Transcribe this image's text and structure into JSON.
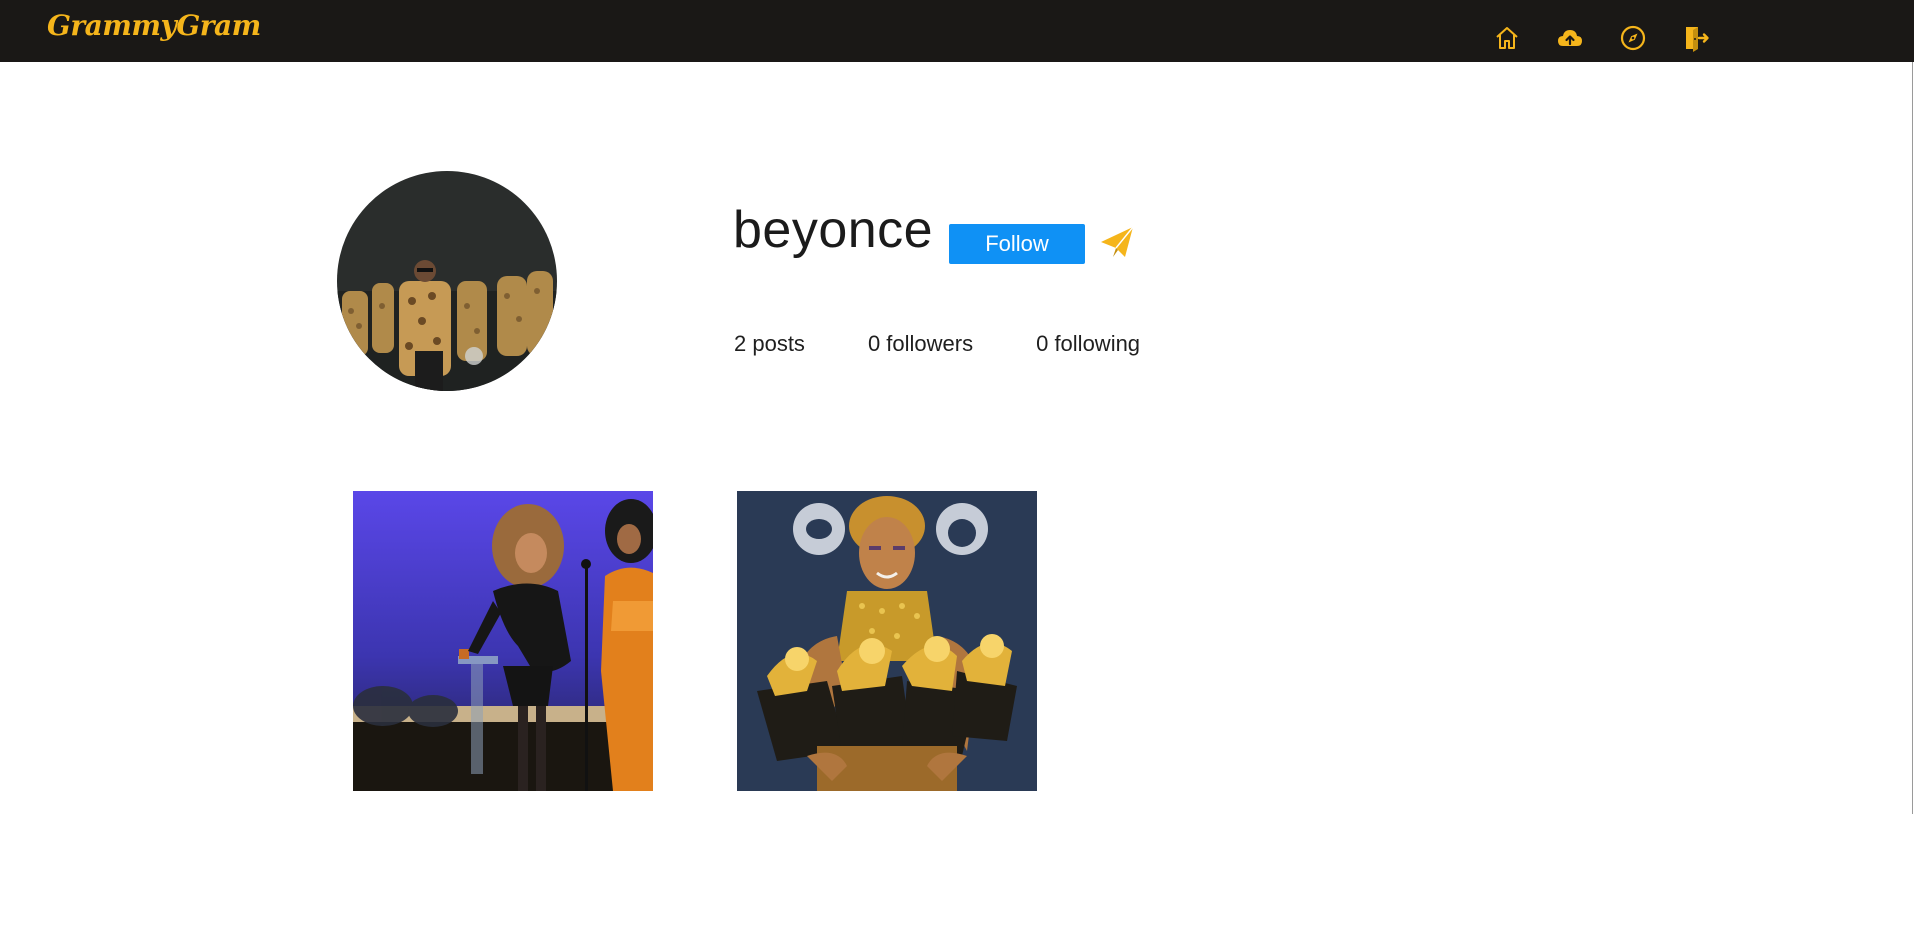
{
  "app": {
    "brand": "GrammyGram"
  },
  "nav": {
    "icons": [
      "home-icon",
      "upload-cloud-icon",
      "explore-compass-icon",
      "logout-icon"
    ],
    "accent_color": "#f5b51b",
    "background_color": "#1a1816"
  },
  "profile": {
    "username": "beyonce",
    "follow_label": "Follow",
    "follow_color": "#0f91f5",
    "message_icon": "paper-plane-icon",
    "stats": {
      "posts": "2 posts",
      "followers": "0 followers",
      "following": "0 following"
    }
  },
  "posts": [
    {
      "icon": "post-photo-1"
    },
    {
      "icon": "post-photo-2"
    }
  ]
}
